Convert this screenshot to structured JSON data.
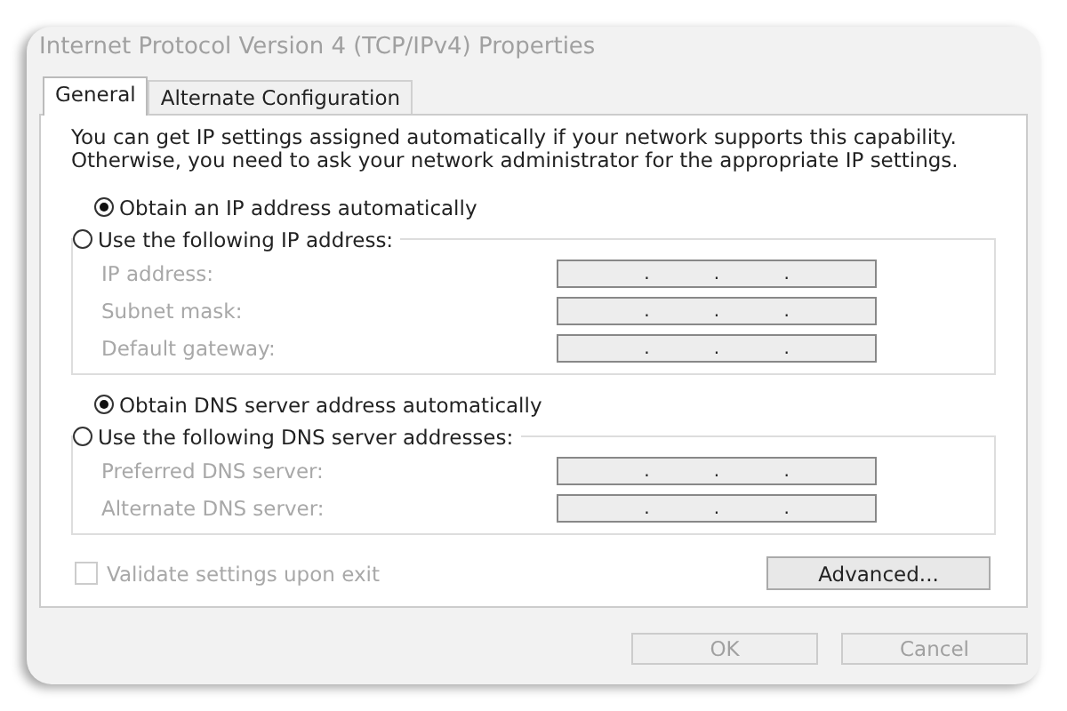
{
  "window": {
    "title": "Internet Protocol Version 4 (TCP/IPv4) Properties"
  },
  "tabs": [
    {
      "label": "General",
      "selected": true
    },
    {
      "label": "Alternate Configuration",
      "selected": false
    }
  ],
  "description": "You can get IP settings assigned automatically if your network supports this capability. Otherwise, you need to ask your network administrator for the appropriate IP settings.",
  "sections": [
    {
      "auto": {
        "label": "Obtain an IP address automatically",
        "selected": true
      },
      "manual": {
        "label": "Use the following IP address:",
        "selected": false
      },
      "fields": [
        {
          "label": "IP address:",
          "disabled": true,
          "separators": [
            ".",
            ".",
            "."
          ]
        },
        {
          "label": "Subnet mask:",
          "disabled": true,
          "separators": [
            ".",
            ".",
            "."
          ]
        },
        {
          "label": "Default gateway:",
          "disabled": true,
          "separators": [
            ".",
            ".",
            "."
          ]
        }
      ]
    },
    {
      "auto": {
        "label": "Obtain DNS server address automatically",
        "selected": true
      },
      "manual": {
        "label": "Use the following DNS server addresses:",
        "selected": false
      },
      "fields": [
        {
          "label": "Preferred DNS server:",
          "disabled": true,
          "separators": [
            ".",
            ".",
            "."
          ]
        },
        {
          "label": "Alternate DNS server:",
          "disabled": true,
          "separators": [
            ".",
            ".",
            "."
          ]
        }
      ]
    }
  ],
  "validate": {
    "label": "Validate settings upon exit",
    "checked": false,
    "disabled": true
  },
  "advanced_button": {
    "label": "Advanced..."
  },
  "buttons": [
    {
      "label": "OK",
      "disabled": true
    },
    {
      "label": "Cancel",
      "disabled": true
    }
  ]
}
